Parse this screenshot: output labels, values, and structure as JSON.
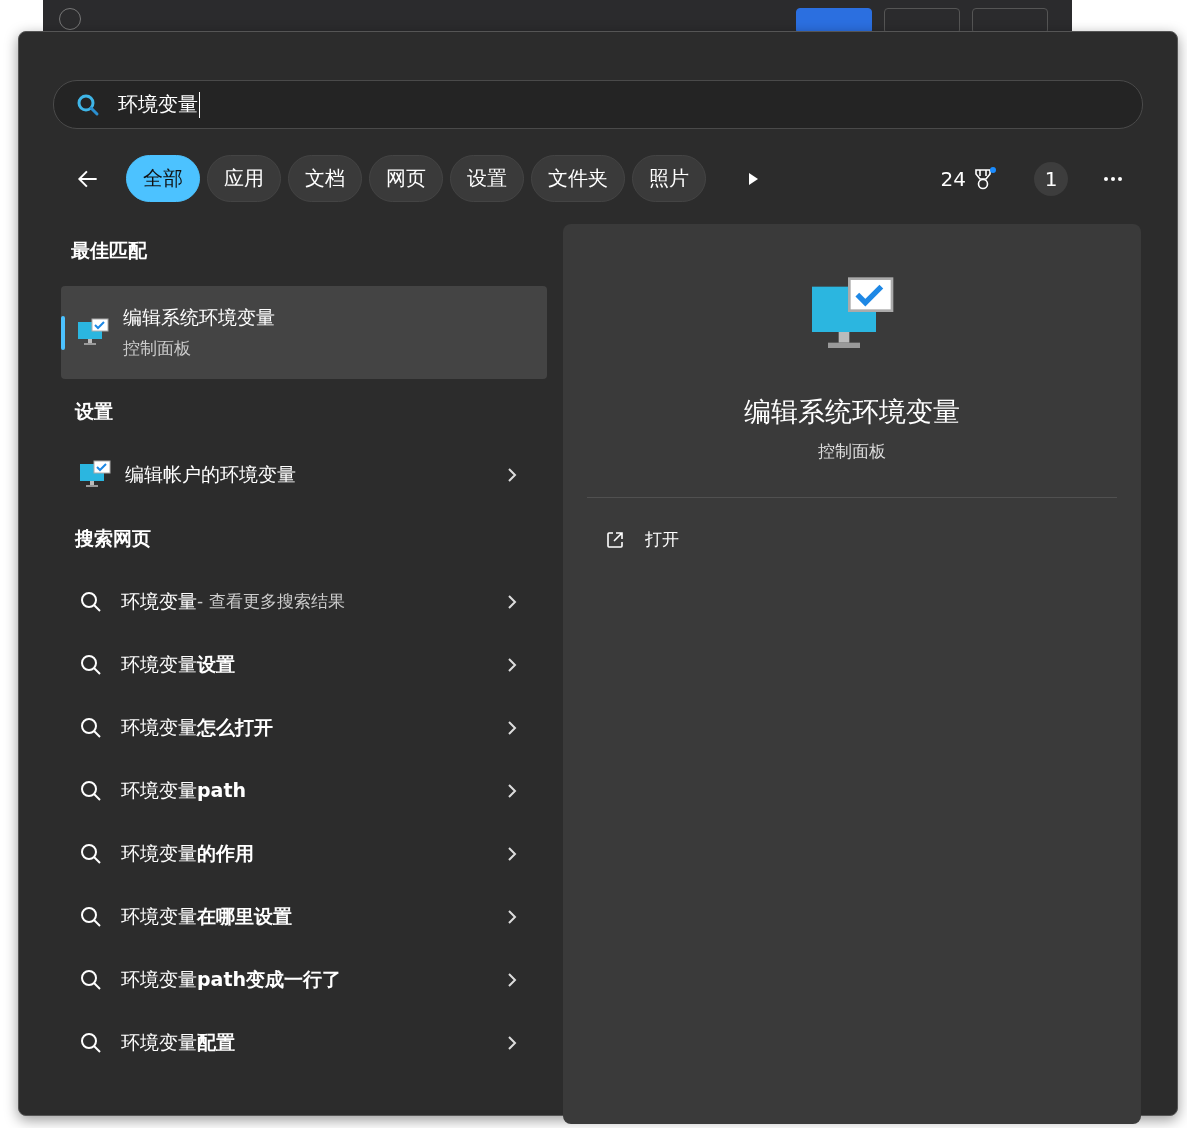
{
  "search": {
    "value": "环境变量"
  },
  "filters": [
    {
      "label": "全部",
      "selected": true
    },
    {
      "label": "应用",
      "selected": false
    },
    {
      "label": "文档",
      "selected": false
    },
    {
      "label": "网页",
      "selected": false
    },
    {
      "label": "设置",
      "selected": false
    },
    {
      "label": "文件夹",
      "selected": false
    },
    {
      "label": "照片",
      "selected": false
    }
  ],
  "points": "24",
  "profile_badge": "1",
  "best_match": {
    "heading": "最佳匹配",
    "title": "编辑系统环境变量",
    "subtitle": "控制面板",
    "selected": true
  },
  "settings": {
    "heading": "设置",
    "items": [
      {
        "label": "编辑帐户的环境变量"
      }
    ]
  },
  "web": {
    "heading": "搜索网页",
    "items": [
      {
        "text": "环境变量",
        "suffix": " - 查看更多搜索结果"
      },
      {
        "text": "环境变量**设置**"
      },
      {
        "text": "环境变量**怎么打开**"
      },
      {
        "text": "环境变量**path**"
      },
      {
        "text": "环境变量**的作用**"
      },
      {
        "text": "环境变量**在哪里设置**"
      },
      {
        "text": "环境变量**path变成一行了**"
      },
      {
        "text": "环境变量**配置**"
      }
    ]
  },
  "detail": {
    "title": "编辑系统环境变量",
    "subtitle": "控制面板",
    "actions": [
      {
        "label": "打开"
      }
    ]
  }
}
